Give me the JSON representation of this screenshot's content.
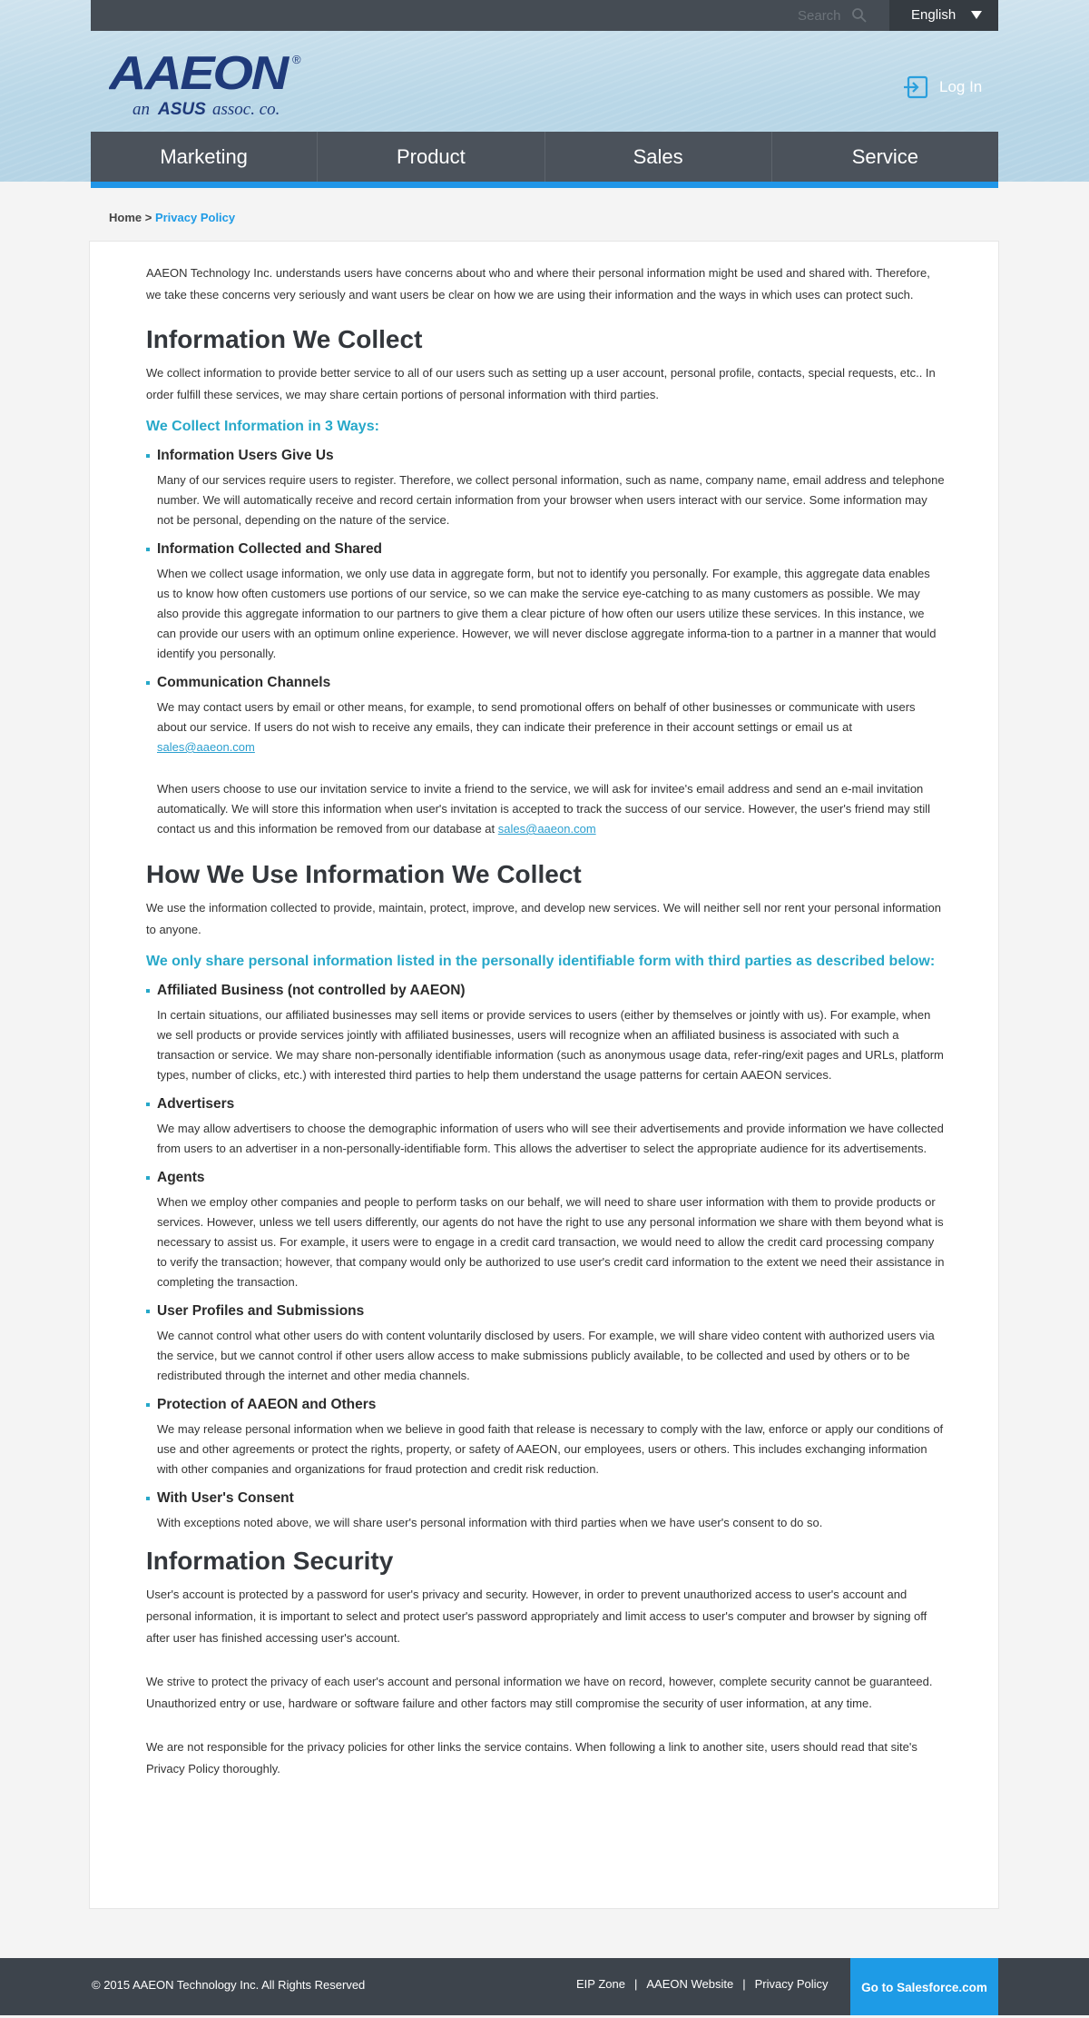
{
  "topbar": {
    "search_placeholder": "Search",
    "language": "English"
  },
  "brand": {
    "logo_text": "AAEON",
    "tagline_prefix": "an",
    "tagline_brand": "ASUS",
    "tagline_suffix": "assoc. co.",
    "registered_mark": "®",
    "colors": {
      "navy": "#1f3a7a",
      "red": "#d9262e"
    }
  },
  "login": {
    "label": "Log In"
  },
  "nav": {
    "items": [
      "Marketing",
      "Product",
      "Sales",
      "Service"
    ]
  },
  "breadcrumb": {
    "home": "Home",
    "separator": " > ",
    "current": "Privacy Policy"
  },
  "intro": "AAEON Technology Inc. understands users have concerns about who and where their personal information might be used and shared with. Therefore, we take these concerns very seriously and want users be clear on how we are using their information and the ways in which uses can protect such.",
  "collect": {
    "title": "Information We Collect",
    "body": "We collect information to provide better service to all of our users such as setting up a user account, personal profile, contacts, special requests, etc.. In order fulfill these services, we may share certain portions of personal information with third parties.",
    "subtitle": "We Collect Information in 3 Ways:",
    "items": [
      {
        "title": "Information Users Give Us",
        "body": "Many of our services require users to register. Therefore, we collect personal information, such as name, company name, email address and telephone number. We will automatically receive and record certain information from your browser when users interact with our service. Some information may not be personal, depending on the nature of the service."
      },
      {
        "title": "Information Collected and Shared",
        "body": "When we collect usage information, we only use data in aggregate form, but not to identify you personally. For example, this aggregate data enables us to know how often customers use portions of our service, so we can make the service eye-catching to as many customers as possible. We may also provide this aggregate information to our partners to give them a clear picture of how often our users utilize these services. In this instance, we can provide our users with an optimum online experience. However, we will never disclose aggregate informa-tion to a partner in a manner that would identify you personally."
      },
      {
        "title": "Communication Channels",
        "body": "We may contact users by email or other means, for example, to send promotional offers on behalf of other businesses or communicate with users about our service. If users do not wish to receive any emails, they can indicate their preference in their account settings or email us at",
        "email": "sales@aaeon.com"
      }
    ],
    "invite_body": "When users choose to use our invitation service to invite a friend to the service, we will ask for invitee's email address and send an e-mail invitation automatically. We will store this information when user's invitation is accepted to track the success of our service. However, the user's friend may still contact us and this information be removed from our database at",
    "invite_email": "sales@aaeon.com"
  },
  "use": {
    "title": "How We Use Information We Collect",
    "body": "We use the information collected to provide, maintain, protect, improve, and develop new services. We will neither sell nor rent your personal information to anyone.",
    "subtitle": "We only share personal information listed in the personally identifiable form with third parties as described below:",
    "items": [
      {
        "title": "Affiliated Business (not controlled by AAEON)",
        "body": "In certain situations, our affiliated businesses may sell items or provide services to users (either by themselves or jointly with us). For example, when we sell products or provide services jointly with affiliated businesses, users will recognize when an affiliated business is associated with such a transaction or service. We may share non-personally identifiable information (such as anonymous usage data, refer-ring/exit pages and URLs, platform types, number of clicks, etc.) with interested third parties to help them understand the usage patterns for certain AAEON services."
      },
      {
        "title": "Advertisers",
        "body": "We may allow advertisers to choose the demographic information of users who will see their advertisements and provide information we have collected from users to an advertiser in a non-personally-identifiable form. This allows the advertiser to select the appropriate audience for its advertisements."
      },
      {
        "title": "Agents",
        "body": "When we employ other companies and people to perform tasks on our behalf, we will need to share user information with them to provide products or services. However, unless we tell users differently, our agents do not have the right to use any personal information we share with them beyond what is necessary to assist us. For example, it users were to engage in a credit card transaction, we would need to allow the credit card processing company to verify the transaction; however, that company would only be authorized to use user's credit card information to the extent we need their assistance in completing the transaction."
      },
      {
        "title": "User Profiles and Submissions",
        "body": "We cannot control what other users do with content voluntarily disclosed by users. For example, we will share video content with authorized users via the service, but we cannot control if other users allow access to make submissions publicly available, to be collected and used by others or to be redistributed through the internet and other media channels."
      },
      {
        "title": "Protection of AAEON and Others",
        "body": "We may release personal information when we believe in good faith that release is necessary to comply with the law, enforce or apply our conditions of use and other agreements or protect the rights, property, or safety of AAEON, our employees, users or others. This includes exchanging information with other companies and organizations for fraud protection and credit risk reduction."
      },
      {
        "title": "With User's Consent",
        "body": "With exceptions noted above, we will share user's personal information with third parties when we have user's consent to do so."
      }
    ]
  },
  "security": {
    "title": "Information Security",
    "paragraphs": [
      "User's account is protected by a password for user's privacy and security. However, in order to prevent unauthorized access to user's account and personal information, it is important to select and protect user's password appropriately and limit access to user's computer and browser by signing off after user has finished accessing user's account.",
      "We strive to protect the privacy of each user's account and personal information we have on record, however, complete security cannot be guaranteed. Unauthorized entry or use, hardware or software failure and other factors may still compromise the security of user information, at any time.",
      "We are not responsible for the privacy policies for other links the service contains. When following a link to another site, users should read that site's Privacy Policy thoroughly."
    ]
  },
  "footer": {
    "copyright": "© 2015 AAEON Technology Inc. All Rights Reserved",
    "links": [
      "EIP Zone",
      "AAEON Website",
      "Privacy Policy"
    ],
    "separator": "|",
    "cta": "Go to Salesforce.com"
  }
}
